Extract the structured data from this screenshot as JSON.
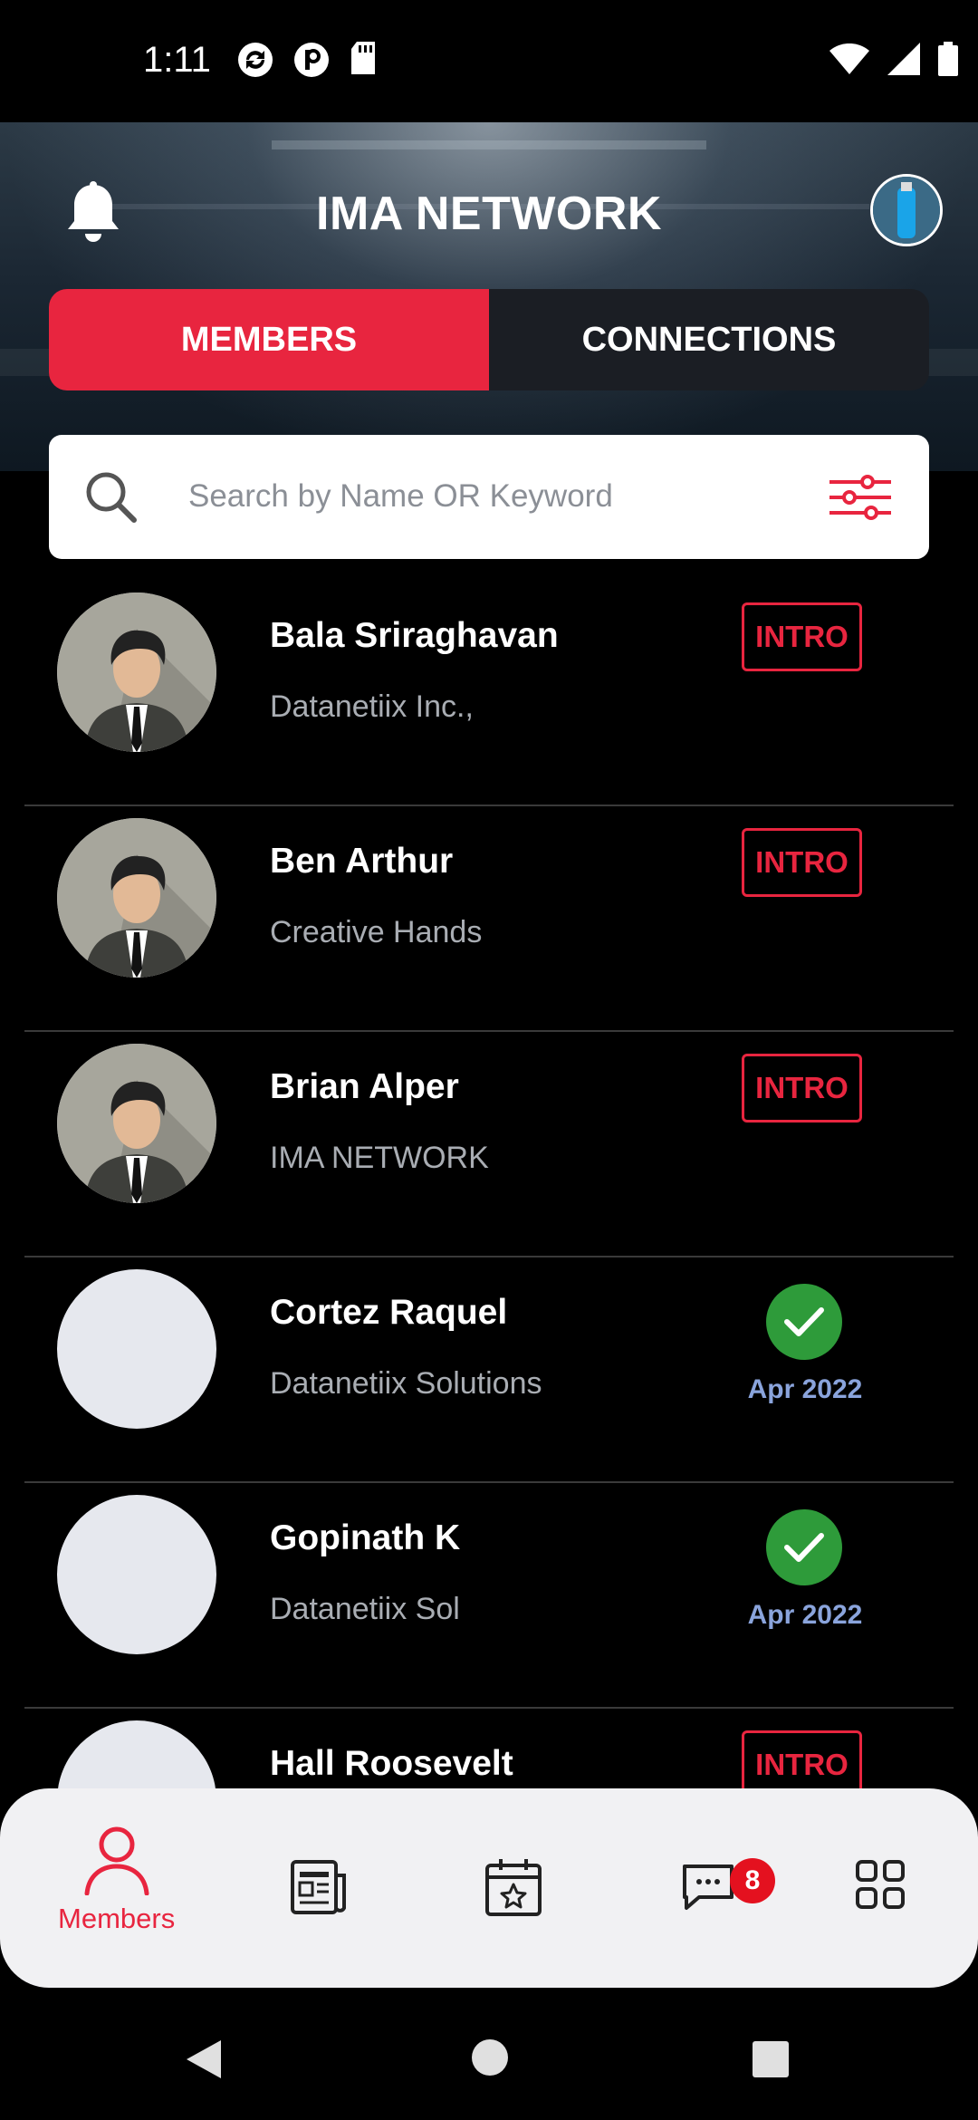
{
  "status_bar": {
    "time": "1:11",
    "left_icons": [
      "sync-icon",
      "circle-p-icon",
      "sd-card-icon"
    ],
    "right_icons": [
      "wifi-icon",
      "signal-icon",
      "battery-icon"
    ]
  },
  "header": {
    "title": "IMA NETWORK",
    "tabs": [
      {
        "label": "MEMBERS",
        "active": true
      },
      {
        "label": "CONNECTIONS",
        "active": false
      }
    ]
  },
  "search": {
    "placeholder": "Search by Name OR Keyword"
  },
  "members": [
    {
      "name": "Bala Sriraghavan",
      "org": "Datanetiix Inc.,",
      "action": "INTRO",
      "avatar": "person-icon"
    },
    {
      "name": "Ben Arthur",
      "org": "Creative Hands",
      "action": "INTRO",
      "avatar": "person-icon"
    },
    {
      "name": "Brian Alper",
      "org": "IMA NETWORK",
      "action": "INTRO",
      "avatar": "person-icon"
    },
    {
      "name": "Cortez Raquel",
      "org": "Datanetiix Solutions",
      "action": "connected",
      "date": "Apr 2022",
      "avatar": "blank"
    },
    {
      "name": "Gopinath K",
      "org": "Datanetiix Sol",
      "action": "connected",
      "date": "Apr 2022",
      "avatar": "blank"
    },
    {
      "name": "Hall Roosevelt",
      "org": "",
      "action": "INTRO",
      "avatar": "blank"
    }
  ],
  "bottom_nav": {
    "items": [
      {
        "label": "Members",
        "icon": "person-outline-icon",
        "active": true
      },
      {
        "label": "",
        "icon": "newspaper-icon"
      },
      {
        "label": "",
        "icon": "calendar-star-icon"
      },
      {
        "label": "",
        "icon": "chat-icon",
        "badge": "8"
      },
      {
        "label": "",
        "icon": "grid-icon"
      }
    ]
  },
  "colors": {
    "accent": "#e8253f",
    "success": "#2e9b3a",
    "date": "#8aa4dc"
  }
}
